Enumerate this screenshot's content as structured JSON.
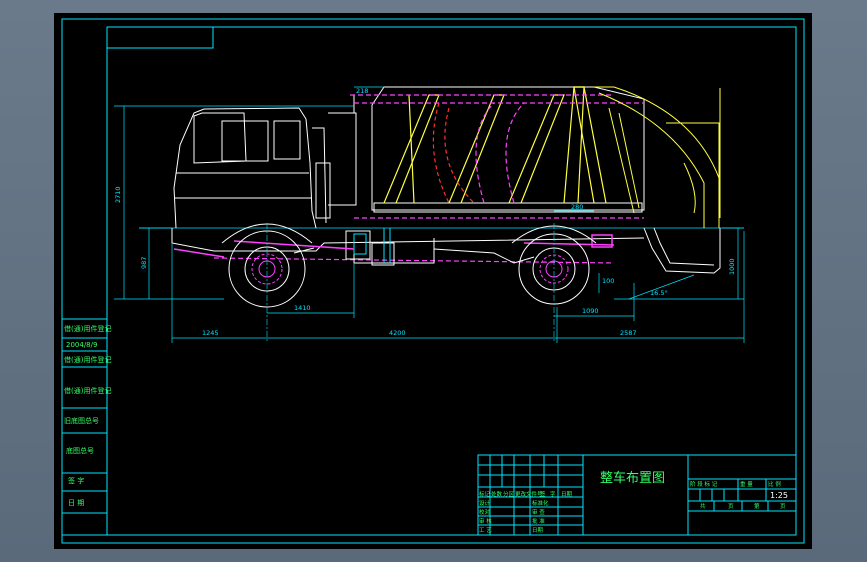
{
  "drawing": {
    "title": "整车布置图",
    "scale": "1:25",
    "colors": {
      "sheet": "#000000",
      "frame": "#00e5ff",
      "outline": "#ffffff",
      "hidden": "#ff40ff",
      "section": "#ff3030",
      "yellow": "#ffff40",
      "text_green": "#33ff66"
    }
  },
  "dimensions": {
    "overall_height": "2710",
    "wheel_height": "987",
    "body_top": "218",
    "hopper_gap": "280",
    "wheelbase_front": "1410",
    "front_overhang": "1245",
    "wheelbase": "4200",
    "rear_overhang": "2587",
    "rear_axle_offset": "1090",
    "rear_low": "100",
    "rear_height": "1000",
    "departure_angle": "16.5°"
  },
  "side_table": {
    "rows": [
      "借(通)用件登记",
      "2004/8/9",
      "借(通)用件登记",
      "旧底图总号",
      "底图总号",
      "签 字",
      "日 期"
    ]
  },
  "title_block": {
    "left_rows": [
      [
        "标记",
        "处数",
        "分区",
        "更改文件号",
        "签",
        "字",
        "日期"
      ],
      [
        "设计",
        "",
        "",
        "标准化",
        "",
        "",
        ""
      ],
      [
        "校对",
        "",
        "",
        "审 查",
        "",
        "",
        ""
      ],
      [
        "审 核",
        "",
        "",
        "批 准",
        "",
        "",
        ""
      ],
      [
        "工 艺",
        "",
        "",
        "日期",
        "",
        "",
        ""
      ]
    ],
    "right_header": [
      "阶 段 标 记",
      "重 量",
      "比 例"
    ],
    "footer": [
      "共",
      "页",
      "第",
      "页"
    ]
  }
}
